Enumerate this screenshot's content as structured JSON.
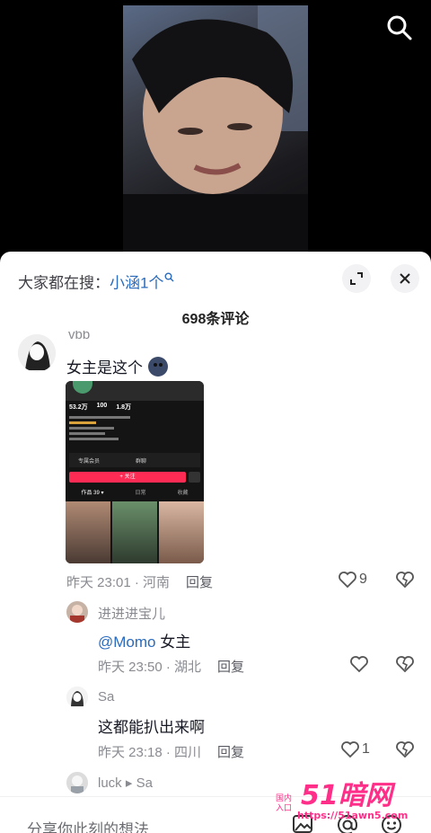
{
  "colors": {
    "accent_link": "#2a6bbd",
    "watermark_pink": "#ff2e88"
  },
  "header": {
    "search_prefix": "大家都在搜：",
    "search_keyword": "小涵1个"
  },
  "comments_count": "698条评论",
  "comments": [
    {
      "name": "vbb",
      "text": "女主是这个",
      "time_location": "昨天 23:01 · 河南",
      "reply_label": "回复",
      "likes": "9"
    }
  ],
  "replies": [
    {
      "name": "进进进宝儿",
      "mention": "@Momo",
      "text": " 女主",
      "time_location": "昨天 23:50 · 湖北",
      "reply_label": "回复",
      "likes": ""
    },
    {
      "name": "Sa",
      "text": "这都能扒出来啊",
      "time_location": "昨天 23:18 · 四川",
      "reply_label": "回复",
      "likes": "1"
    },
    {
      "name": "luck",
      "reply_to": "Sa"
    }
  ],
  "embedded_shot": {
    "stats": [
      "53.2万",
      "100",
      "1.8万"
    ],
    "follow_label": "+ 关注",
    "tabs": [
      "作品 39 ▾",
      "日常",
      "收藏"
    ],
    "row_labels": [
      "专属会员",
      "群聊"
    ]
  },
  "input_placeholder": "分享你此刻的想法",
  "watermark": {
    "text": "51暗网",
    "side": "国内\n入口",
    "url": "https://51awn5.com"
  },
  "icons": [
    "search-icon",
    "expand-icon",
    "close-icon",
    "heart-icon",
    "dislike-icon",
    "image-icon",
    "at-icon",
    "emoji-icon"
  ]
}
